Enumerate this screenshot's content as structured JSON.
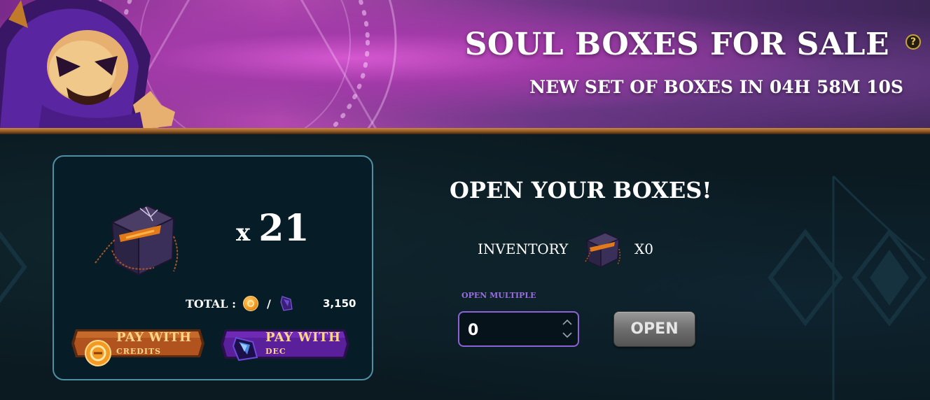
{
  "banner": {
    "title": "SOUL BOXES FOR SALE",
    "subtitle": "NEW SET OF BOXES IN 04H 58M 10S",
    "help_icon": "question-mark-icon"
  },
  "purchase": {
    "quantity_prefix": "x",
    "quantity": "21",
    "total_label": "TOTAL :",
    "total_separator": "/",
    "total_value": "3,150",
    "pay_credits": {
      "line1": "PAY WITH",
      "line2": "CREDITS"
    },
    "pay_dec": {
      "line1": "PAY WITH",
      "line2": "DEC"
    }
  },
  "open_panel": {
    "title": "OPEN YOUR BOXES!",
    "inventory_label": "INVENTORY",
    "inventory_count": "X0",
    "open_multiple_label": "OPEN MULTIPLE",
    "open_multiple_value": "0",
    "open_button": "OPEN"
  },
  "colors": {
    "accent_purple": "#8b63d6",
    "card_border": "#4e8fa3",
    "gold_text": "#ffd58a"
  }
}
